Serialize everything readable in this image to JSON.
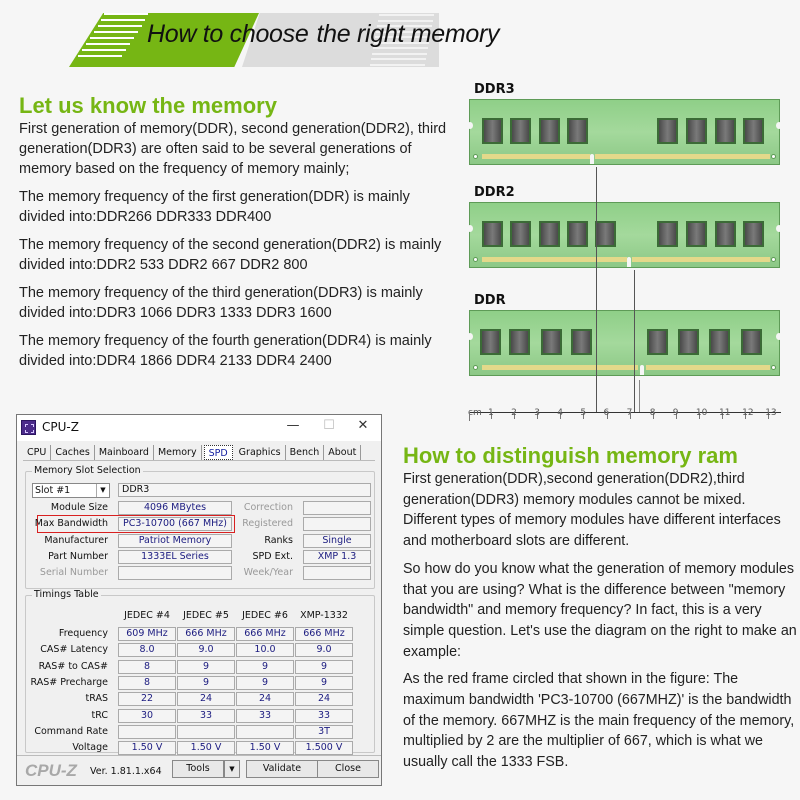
{
  "banner": {
    "title_part1": "How to choose",
    "title_part2": "the right memory",
    "colors": {
      "green": "#76b614",
      "gray": "#dcdcdc"
    }
  },
  "section1": {
    "heading": "Let us know the memory",
    "intro": "First generation of memory(DDR), second generation(DDR2), third generation(DDR3) are often said to be several generations of memory based on the frequency of memory mainly;",
    "items": [
      "The memory frequency of the first generation(DDR) is mainly divided into:DDR266  DDR333  DDR400",
      "The memory frequency of the second generation(DDR2) is mainly divided into:DDR2 533  DDR2 667  DDR2 800",
      "The memory frequency of the third generation(DDR3) is mainly divided into:DDR3 1066  DDR3 1333  DDR3 1600",
      "The memory frequency of the fourth generation(DDR4) is mainly divided into:DDR4 1866  DDR4 2133  DDR4 2400"
    ]
  },
  "ram_diagram": {
    "modules": [
      {
        "label": "DDR3"
      },
      {
        "label": "DDR2"
      },
      {
        "label": "DDR"
      }
    ],
    "ruler": {
      "unit": "cm",
      "ticks": [
        "1",
        "2",
        "3",
        "4",
        "5",
        "6",
        "7",
        "8",
        "9",
        "10",
        "11",
        "12",
        "13"
      ]
    }
  },
  "cpuz": {
    "title": "CPU-Z",
    "window_buttons": {
      "minimize": "—",
      "maximize": "☐",
      "close": "✕"
    },
    "tabs": [
      "CPU",
      "Caches",
      "Mainboard",
      "Memory",
      "SPD",
      "Graphics",
      "Bench",
      "About"
    ],
    "active_tab": "SPD",
    "slot_group_label": "Memory Slot Selection",
    "slot_value": "Slot #1",
    "memory_type": "DDR3",
    "left_fields": [
      {
        "label": "Module Size",
        "value": "4096 MBytes"
      },
      {
        "label": "Max Bandwidth",
        "value": "PC3-10700 (667 MHz)"
      },
      {
        "label": "Manufacturer",
        "value": "Patriot Memory"
      },
      {
        "label": "Part Number",
        "value": "1333EL Series"
      },
      {
        "label": "Serial Number",
        "value": ""
      }
    ],
    "right_fields": [
      {
        "label": "Correction",
        "value": ""
      },
      {
        "label": "Registered",
        "value": ""
      },
      {
        "label": "Ranks",
        "value": "Single"
      },
      {
        "label": "SPD Ext.",
        "value": "XMP 1.3"
      },
      {
        "label": "Week/Year",
        "value": ""
      }
    ],
    "timings": {
      "group_label": "Timings Table",
      "columns": [
        "JEDEC #4",
        "JEDEC #5",
        "JEDEC #6",
        "XMP-1332"
      ],
      "rows": [
        {
          "label": "Frequency",
          "values": [
            "609 MHz",
            "666 MHz",
            "666 MHz",
            "666 MHz"
          ]
        },
        {
          "label": "CAS# Latency",
          "values": [
            "8.0",
            "9.0",
            "10.0",
            "9.0"
          ]
        },
        {
          "label": "RAS# to CAS#",
          "values": [
            "8",
            "9",
            "9",
            "9"
          ]
        },
        {
          "label": "RAS# Precharge",
          "values": [
            "8",
            "9",
            "9",
            "9"
          ]
        },
        {
          "label": "tRAS",
          "values": [
            "22",
            "24",
            "24",
            "24"
          ]
        },
        {
          "label": "tRC",
          "values": [
            "30",
            "33",
            "33",
            "33"
          ]
        },
        {
          "label": "Command Rate",
          "values": [
            "",
            "",
            "",
            "3T"
          ]
        },
        {
          "label": "Voltage",
          "values": [
            "1.50 V",
            "1.50 V",
            "1.50 V",
            "1.500 V"
          ]
        }
      ]
    },
    "footer": {
      "brand": "CPU-Z",
      "version": "Ver. 1.81.1.x64",
      "tools_label": "Tools",
      "validate_label": "Validate",
      "close_label": "Close"
    },
    "highlight_color": "#d82020"
  },
  "section2": {
    "heading": "How to distinguish memory ram",
    "paragraphs": [
      "First generation(DDR),second generation(DDR2),third generation(DDR3) memory modules cannot be mixed. Different types of memory modules have different interfaces and motherboard slots are different.",
      "So how do you know what the generation of memory modules that you are using? What is the difference between \"memory bandwidth\" and memory frequency? In fact, this is a very simple question. Let's use the diagram on the right to make an example:",
      "As the red frame circled that shown in the figure: The maximum bandwidth 'PC3-10700 (667MHZ)' is the bandwidth of the memory. 667MHZ is the main frequency of the memory, multiplied by 2 are the multiplier of 667, which is what we usually call the 1333 FSB."
    ]
  }
}
